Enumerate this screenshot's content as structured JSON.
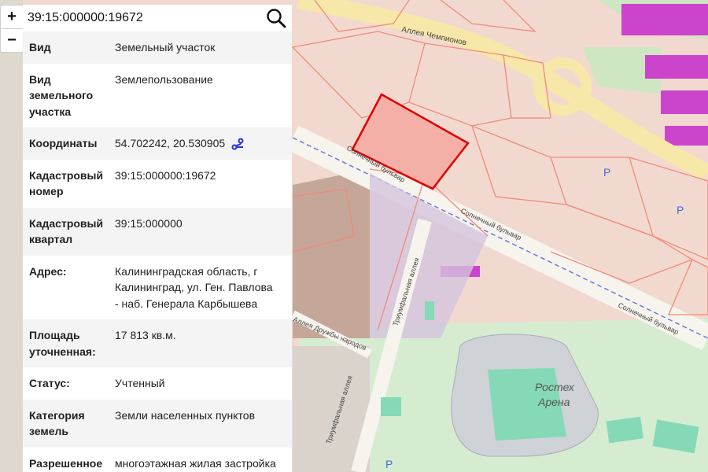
{
  "search": {
    "value": "39:15:000000:19672"
  },
  "zoom": {
    "in_label": "+",
    "out_label": "−"
  },
  "details": [
    {
      "key": "Вид",
      "value": "Земельный участок"
    },
    {
      "key": "Вид земельного участка",
      "value": "Землепользование"
    },
    {
      "key": "Координаты",
      "value": "54.702242, 20.530905"
    },
    {
      "key": "Кадастровый номер",
      "value": "39:15:000000:19672"
    },
    {
      "key": "Кадастровый квартал",
      "value": "39:15:000000"
    },
    {
      "key": "Адрес:",
      "value": "Калининградская область, г Калининград, ул. Ген. Павлова - наб. Генерала Карбышева"
    },
    {
      "key": "Площадь уточненная:",
      "value": "17 813 кв.м."
    },
    {
      "key": "Статус:",
      "value": "Учтенный"
    },
    {
      "key": "Категория земель",
      "value": "Земли населенных пунктов"
    },
    {
      "key": "Разрешенное",
      "value": "многоэтажная жилая застройка"
    }
  ],
  "map_labels": {
    "alley_champions": "Аллея Чемпионов",
    "solnechny_1": "Солнечный бульвар",
    "solnechny_2": "Солнечный бульвар",
    "solnechny_3": "Солнечный бульвар",
    "triumph_1": "Триумфальная аллея",
    "triumph_2": "Триумфальная аллея",
    "friendship": "Аллея Дружбы народов",
    "arena_1": "Ростех",
    "arena_2": "Арена",
    "parking_1": "P",
    "parking_2": "P",
    "parking_3": "P"
  },
  "colors": {
    "parcel_fill": "#f4b7ae",
    "parcel_border": "#e00000",
    "cadastre_line": "#f08a7a",
    "green": "#d4ecc9",
    "stadium_field": "#85d9b6",
    "residential": "#cc44cc"
  }
}
